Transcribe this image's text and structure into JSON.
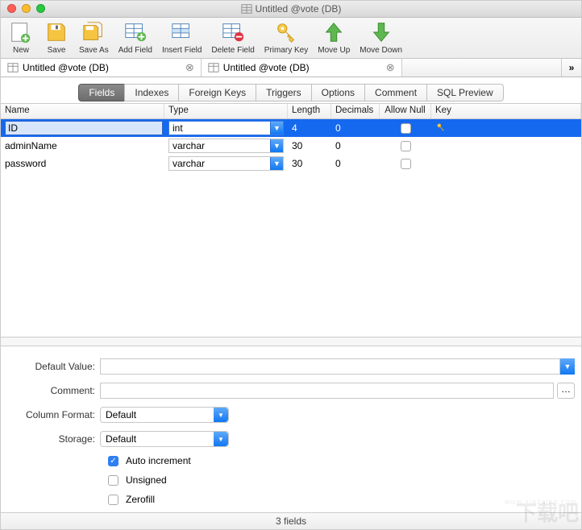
{
  "window": {
    "title": "Untitled @vote (DB)"
  },
  "toolbar": {
    "new": "New",
    "save": "Save",
    "save_as": "Save As",
    "add_field": "Add Field",
    "insert_field": "Insert Field",
    "delete_field": "Delete Field",
    "primary_key": "Primary Key",
    "move_up": "Move Up",
    "move_down": "Move Down"
  },
  "tabs": {
    "items": [
      {
        "label": "Untitled @vote (DB)"
      },
      {
        "label": "Untitled @vote (DB)"
      }
    ]
  },
  "modes": {
    "fields": "Fields",
    "indexes": "Indexes",
    "foreign_keys": "Foreign Keys",
    "triggers": "Triggers",
    "options": "Options",
    "comment": "Comment",
    "sql_preview": "SQL Preview"
  },
  "grid": {
    "headers": {
      "name": "Name",
      "type": "Type",
      "length": "Length",
      "decimals": "Decimals",
      "allow_null": "Allow Null",
      "key": "Key"
    },
    "rows": [
      {
        "name": "ID",
        "type": "int",
        "length": "4",
        "decimals": "0",
        "allow_null": false,
        "key": true,
        "selected": true
      },
      {
        "name": "adminName",
        "type": "varchar",
        "length": "30",
        "decimals": "0",
        "allow_null": false,
        "key": false,
        "selected": false
      },
      {
        "name": "password",
        "type": "varchar",
        "length": "30",
        "decimals": "0",
        "allow_null": false,
        "key": false,
        "selected": false
      }
    ]
  },
  "form": {
    "default_value": {
      "label": "Default Value:",
      "value": ""
    },
    "comment": {
      "label": "Comment:",
      "value": ""
    },
    "column_format": {
      "label": "Column Format:",
      "value": "Default"
    },
    "storage": {
      "label": "Storage:",
      "value": "Default"
    },
    "auto_increment": {
      "label": "Auto increment",
      "checked": true
    },
    "unsigned": {
      "label": "Unsigned",
      "checked": false
    },
    "zerofill": {
      "label": "Zerofill",
      "checked": false
    }
  },
  "status": {
    "text": "3 fields"
  },
  "watermark": {
    "main": "下载吧",
    "sub": "www.xiazaiba.com"
  }
}
